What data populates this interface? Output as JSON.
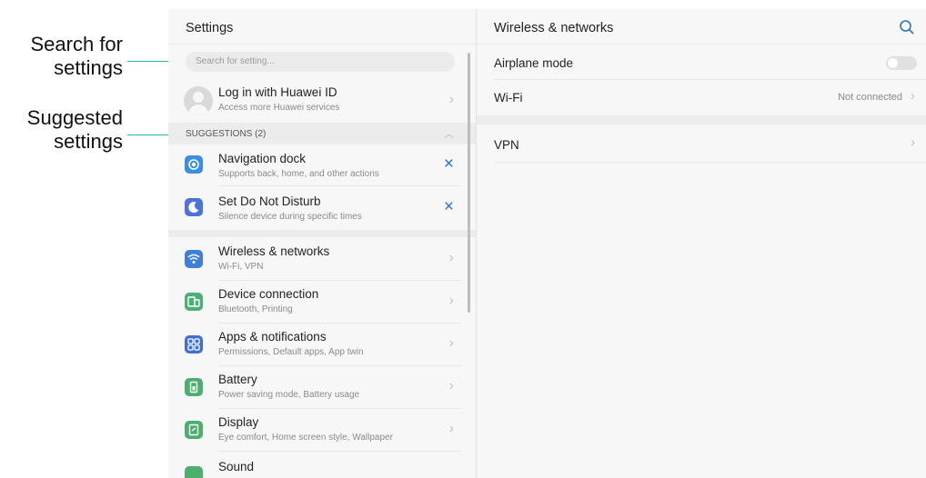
{
  "annotations": {
    "search": [
      "Search for",
      "settings"
    ],
    "suggested": [
      "Suggested",
      "settings"
    ],
    "accent": "#2ab3b8"
  },
  "left": {
    "title": "Settings",
    "search_placeholder": "Search for setting...",
    "account": {
      "title": "Log in with Huawei ID",
      "subtitle": "Access more Huawei services"
    },
    "suggestions_header": "SUGGESTIONS (2)",
    "suggestions": [
      {
        "title": "Navigation dock",
        "subtitle": "Supports back, home, and other actions",
        "icon": "navigation-dock-icon",
        "color": "#3a8ee6"
      },
      {
        "title": "Set Do Not Disturb",
        "subtitle": "Silence device during specific times",
        "icon": "moon-icon",
        "color": "#4a74d9"
      }
    ],
    "items": [
      {
        "title": "Wireless & networks",
        "subtitle": "Wi-Fi, VPN",
        "icon": "wifi-icon",
        "color": "#3f7fd8"
      },
      {
        "title": "Device connection",
        "subtitle": "Bluetooth, Printing",
        "icon": "device-connection-icon",
        "color": "#4caf78"
      },
      {
        "title": "Apps & notifications",
        "subtitle": "Permissions, Default apps, App twin",
        "icon": "apps-icon",
        "color": "#3f6fd0"
      },
      {
        "title": "Battery",
        "subtitle": "Power saving mode, Battery usage",
        "icon": "battery-icon",
        "color": "#4caf6e"
      },
      {
        "title": "Display",
        "subtitle": "Eye comfort, Home screen style, Wallpaper",
        "icon": "display-icon",
        "color": "#4caf6e"
      },
      {
        "title": "Sound",
        "subtitle": "",
        "icon": "sound-icon",
        "color": "#4caf6e"
      }
    ]
  },
  "right": {
    "title": "Wireless & networks",
    "airplane": {
      "title": "Airplane mode",
      "on": false
    },
    "wifi": {
      "title": "Wi-Fi",
      "value": "Not connected"
    },
    "vpn": {
      "title": "VPN"
    },
    "accent": "#2d6fcf"
  }
}
